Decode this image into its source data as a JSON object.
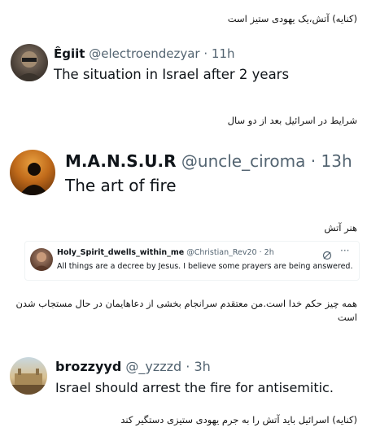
{
  "captions": {
    "c1": "(کنایه) آتش،یک یهودی ستیز است",
    "c2": "شرایط در اسرائیل بعد از دو سال",
    "c3": "هنر آتش",
    "c4": "همه چیز حکم خدا است.من معتقدم سرانجام بخشی از دعاهایمان در حال مستجاب شدن است",
    "c5": "(کنایه) اسرائیل باید آتش را به جرم یهودی ستیزی دستگیر کند"
  },
  "tweet1": {
    "name": "Êgiit",
    "handle": "@electroendezyar",
    "time": "· 11h",
    "text": "The situation in Israel after 2 years"
  },
  "tweet2": {
    "name": "M.A.N.S.U.R",
    "handle": "@uncle_ciroma",
    "time": "· 13h",
    "text": "The art of fire"
  },
  "tweet3": {
    "name": "Holy_Spirit_dwells_within_me",
    "handle": "@Christian_Rev20",
    "time": "· 2h",
    "text": "All things are a decree by Jesus. I believe some prayers are being answered."
  },
  "tweet4": {
    "name": "brozzyyd",
    "handle": "@_yzzzd",
    "time": "· 3h",
    "text": "Israel should arrest the fire for antisemitic."
  }
}
